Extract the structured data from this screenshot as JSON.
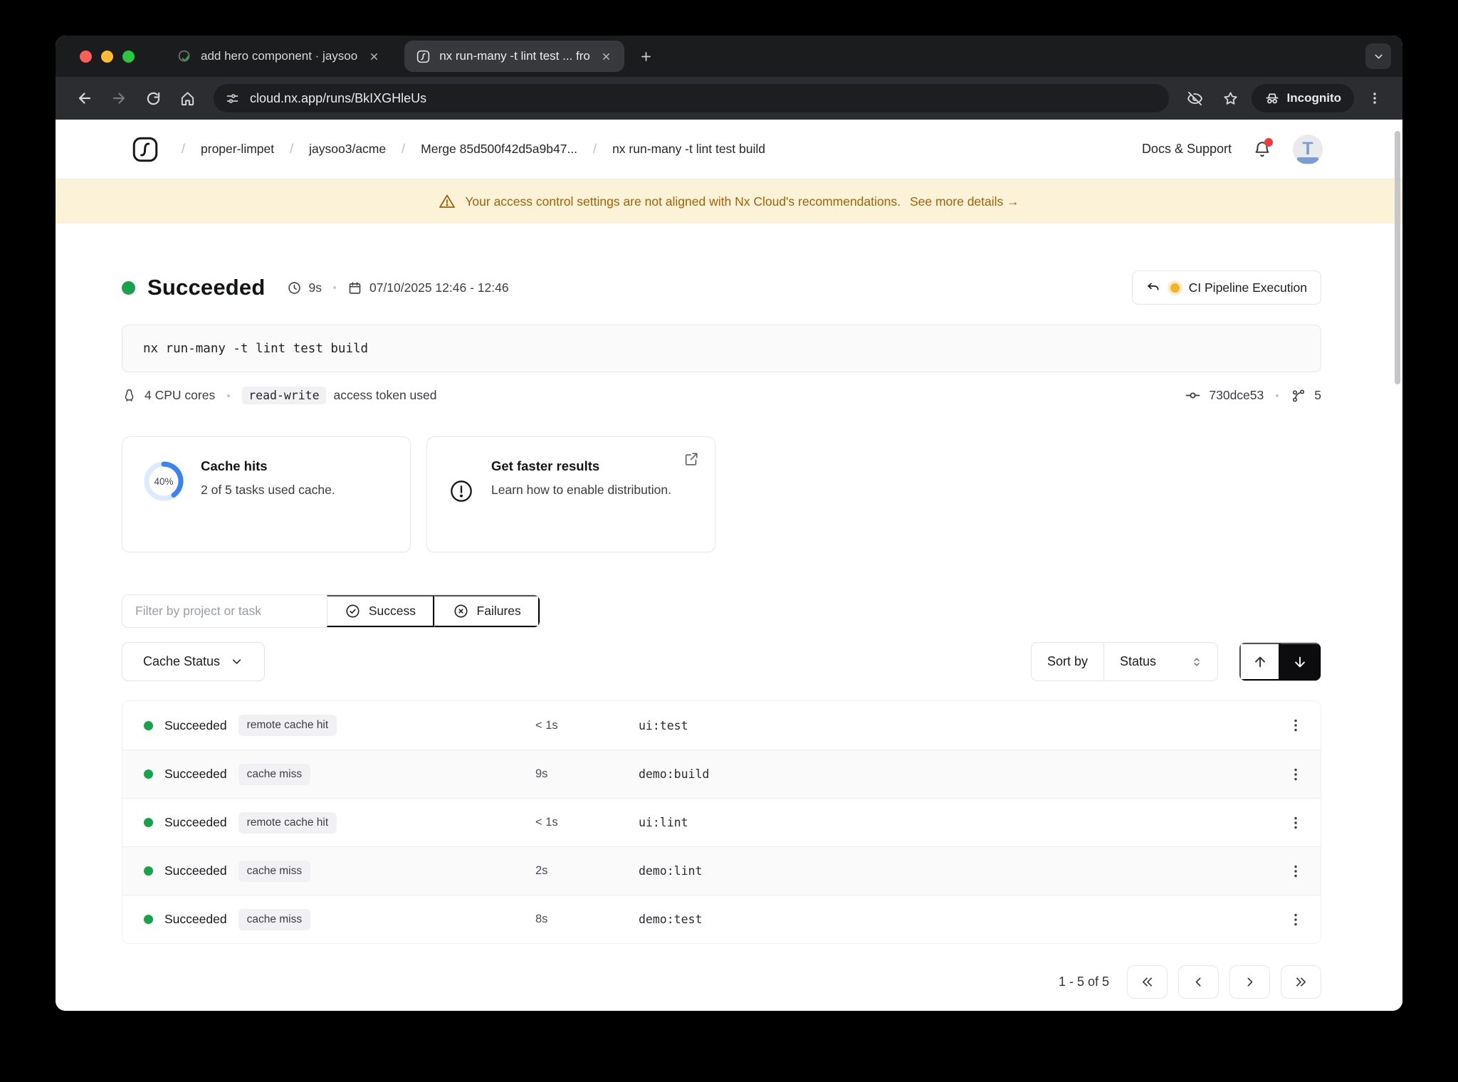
{
  "browser": {
    "tabs": [
      {
        "title": "add hero component · jaysoo",
        "favicon": "github-pr-check-icon"
      },
      {
        "title": "nx run-many -t lint test ... fro",
        "favicon": "nx-logo-icon"
      }
    ],
    "url": "cloud.nx.app/runs/BkIXGHleUs",
    "incognito_label": "Incognito"
  },
  "header": {
    "breadcrumbs": [
      "proper-limpet",
      "jaysoo3/acme",
      "Merge 85d500f42d5a9b47...",
      "nx run-many -t lint test build"
    ],
    "docs_support": "Docs & Support",
    "avatar_initial": "T"
  },
  "banner": {
    "text": "Your access control settings are not aligned with Nx Cloud's recommendations.",
    "link": "See more details →"
  },
  "run": {
    "status": "Succeeded",
    "duration": "9s",
    "timestamp": "07/10/2025 12:46 - 12:46",
    "pipeline_button": "CI Pipeline Execution",
    "command": "nx run-many -t lint test build",
    "cpu": "4 CPU cores",
    "token": "read-write",
    "token_suffix": "access token used",
    "commit": "730dce53",
    "branch_count": "5"
  },
  "cards": {
    "cache": {
      "title": "Cache hits",
      "subtitle": "2 of 5 tasks used cache.",
      "percent": "40%",
      "percent_value": 40
    },
    "faster": {
      "title": "Get faster results",
      "subtitle": "Learn how to enable distribution."
    }
  },
  "filters": {
    "placeholder": "Filter by project or task",
    "success": "Success",
    "failures": "Failures",
    "cache_status": "Cache Status",
    "sort_by": "Sort by",
    "sort_value": "Status"
  },
  "table": {
    "rows": [
      {
        "status": "Succeeded",
        "badge": "remote cache hit",
        "duration": "< 1s",
        "task": "ui:test"
      },
      {
        "status": "Succeeded",
        "badge": "cache miss",
        "duration": "9s",
        "task": "demo:build"
      },
      {
        "status": "Succeeded",
        "badge": "remote cache hit",
        "duration": "< 1s",
        "task": "ui:lint"
      },
      {
        "status": "Succeeded",
        "badge": "cache miss",
        "duration": "2s",
        "task": "demo:lint"
      },
      {
        "status": "Succeeded",
        "badge": "cache miss",
        "duration": "8s",
        "task": "demo:test"
      }
    ]
  },
  "pagination": {
    "label": "1 - 5 of 5"
  },
  "icons": {
    "bell-icon": "🔔",
    "warning-icon": "⚠",
    "clock-icon": "🕐",
    "calendar-icon": "📅",
    "undo-icon": "↩",
    "linux-icon": "🐧",
    "commit-icon": "-o-",
    "branch-icon": "⎇",
    "external-link-icon": "↗",
    "check-circle-icon": "✓",
    "x-circle-icon": "✕",
    "chevron-down-icon": "⌄",
    "arrow-up-icon": "↑",
    "arrow-down-icon": "↓",
    "kebab-icon": "⋮"
  },
  "colors": {
    "success_green": "#16a34a",
    "accent_blue": "#3b82f6",
    "warning_amber": "#a16207",
    "banner_bg": "#fbf2d8",
    "pipeline_dot": "#f0b429"
  }
}
